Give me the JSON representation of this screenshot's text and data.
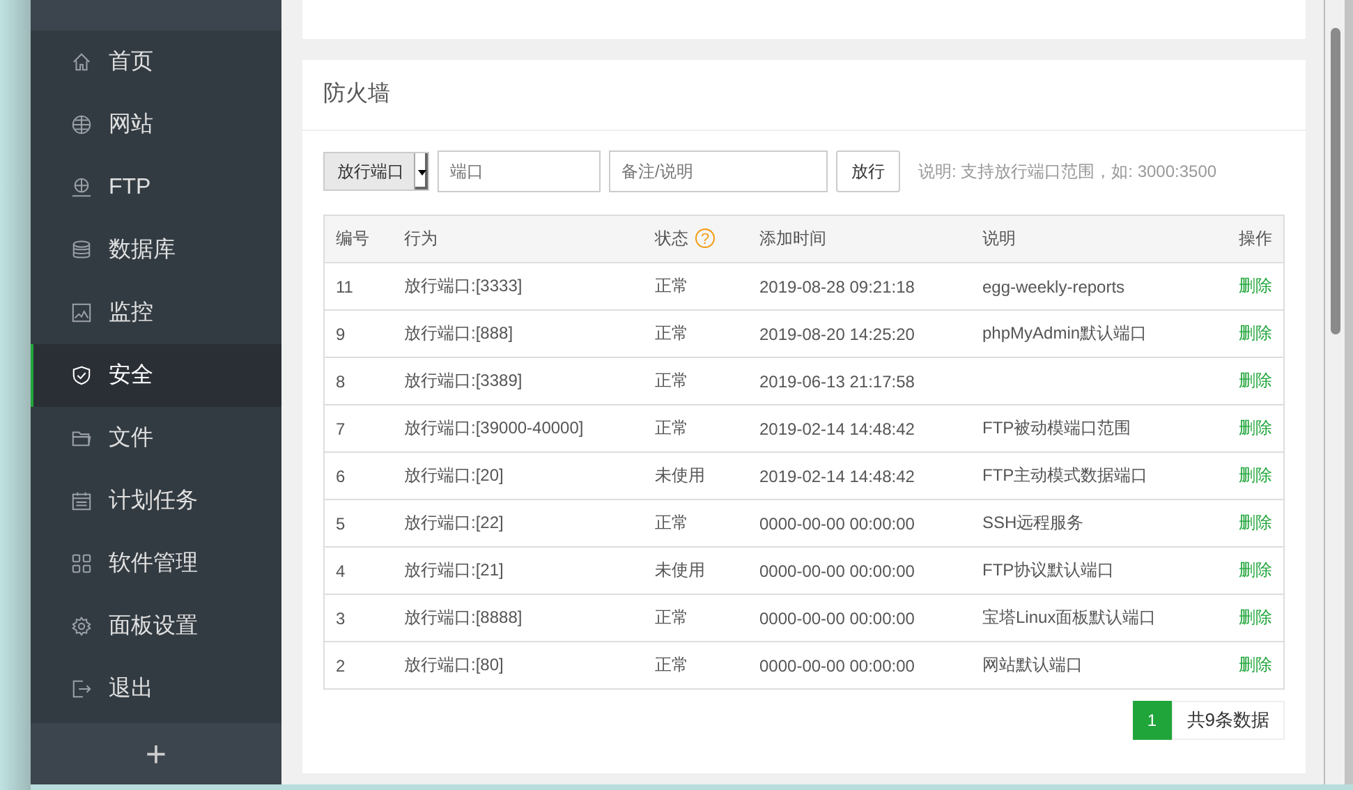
{
  "sidebar": {
    "items": [
      {
        "label": "首页",
        "kind": "home",
        "selected": false
      },
      {
        "label": "网站",
        "kind": "globe",
        "selected": false
      },
      {
        "label": "FTP",
        "kind": "ftp",
        "selected": false
      },
      {
        "label": "数据库",
        "kind": "database",
        "selected": false
      },
      {
        "label": "监控",
        "kind": "monitor",
        "selected": false
      },
      {
        "label": "安全",
        "kind": "shield",
        "selected": true
      },
      {
        "label": "文件",
        "kind": "folder",
        "selected": false
      },
      {
        "label": "计划任务",
        "kind": "calendar",
        "selected": false
      },
      {
        "label": "软件管理",
        "kind": "grid",
        "selected": false
      },
      {
        "label": "面板设置",
        "kind": "gear",
        "selected": false
      },
      {
        "label": "退出",
        "kind": "logout",
        "selected": false
      }
    ],
    "add_button": "+"
  },
  "firewall": {
    "title": "防火墙",
    "toolbar": {
      "select": "放行端口",
      "port_placeholder": "端口",
      "note_placeholder": "备注/说明",
      "button": "放行",
      "hint": "说明: 支持放行端口范围，如: 3000:3500"
    },
    "table": {
      "columns": [
        "编号",
        "行为",
        "状态",
        "添加时间",
        "说明",
        "操作"
      ],
      "status_help": "?",
      "rows": [
        {
          "id": "11",
          "action": "放行端口:[3333]",
          "status": "正常",
          "time": "2019-08-28 09:21:18",
          "note": "egg-weekly-reports",
          "op": "删除"
        },
        {
          "id": "9",
          "action": "放行端口:[888]",
          "status": "正常",
          "time": "2019-08-20 14:25:20",
          "note": "phpMyAdmin默认端口",
          "op": "删除"
        },
        {
          "id": "8",
          "action": "放行端口:[3389]",
          "status": "正常",
          "time": "2019-06-13 21:17:58",
          "op": "删除"
        },
        {
          "id": "7",
          "action": "放行端口:[39000-40000]",
          "status": "正常",
          "time": "2019-02-14 14:48:42",
          "note": "FTP被动模端口范围",
          "op": "删除"
        },
        {
          "id": "6",
          "action": "放行端口:[20]",
          "status": "未使用",
          "time": "2019-02-14 14:48:42",
          "note": "FTP主动模式数据端口",
          "op": "删除"
        },
        {
          "id": "5",
          "action": "放行端口:[22]",
          "status": "正常",
          "time": "0000-00-00 00:00:00",
          "note": "SSH远程服务",
          "op": "删除"
        },
        {
          "id": "4",
          "action": "放行端口:[21]",
          "status": "未使用",
          "time": "0000-00-00 00:00:00",
          "note": "FTP协议默认端口",
          "op": "删除"
        },
        {
          "id": "3",
          "action": "放行端口:[8888]",
          "status": "正常",
          "time": "0000-00-00 00:00:00",
          "note": "宝塔Linux面板默认端口",
          "op": "删除"
        },
        {
          "id": "2",
          "action": "放行端口:[80]",
          "status": "正常",
          "time": "0000-00-00 00:00:00",
          "note": "网站默认端口",
          "op": "删除"
        }
      ]
    },
    "pagination": {
      "pages": [
        {
          "label": "1",
          "selected": true
        }
      ],
      "total": "共9条数据"
    }
  }
}
